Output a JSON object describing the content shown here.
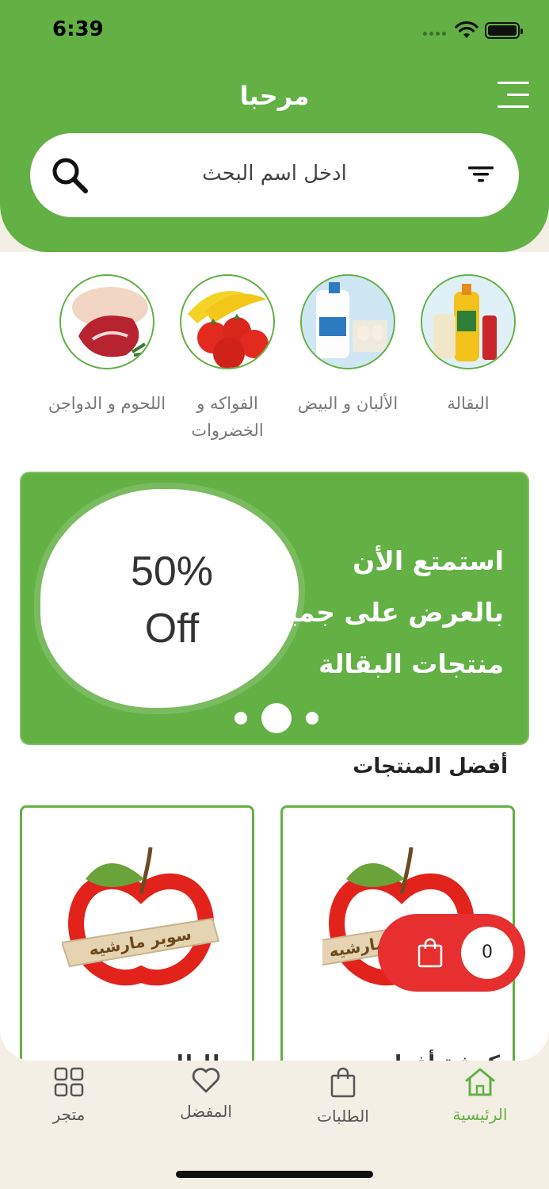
{
  "status": {
    "time": "6:39"
  },
  "header": {
    "title": "مرحبا"
  },
  "search": {
    "placeholder": "ادخل اسم البحث"
  },
  "categories": [
    {
      "label": "البقالة"
    },
    {
      "label": "الألبان و البيض"
    },
    {
      "label": "الفواكه و الخضروات"
    },
    {
      "label": "اللحوم و الدواجن"
    }
  ],
  "banner": {
    "discount_percent": "50%",
    "discount_off": "Off",
    "line1": "استمتع الأن",
    "line2": "بالعرض على جميع",
    "line3": "منتجات البقالة",
    "active_slide": 2,
    "slide_count": 3
  },
  "products_section": {
    "title": "أفضل المنتجات"
  },
  "products": [
    {
      "name": "كوشة أفراح",
      "logo_text": "سوبر مارشيه"
    },
    {
      "name": "بطاطا",
      "logo_text": "سوبر مارشيه"
    }
  ],
  "cart": {
    "count": "0"
  },
  "tabs": [
    {
      "label": "الرئيسية",
      "icon": "home-icon",
      "active": true
    },
    {
      "label": "الطلبات",
      "icon": "bag-icon",
      "active": false
    },
    {
      "label": "المفضل",
      "icon": "heart-icon",
      "active": false
    },
    {
      "label": "متجر",
      "icon": "grid-icon",
      "active": false
    }
  ],
  "colors": {
    "primary": "#63b045",
    "cart": "#e72f2f",
    "background": "#f4efe5"
  }
}
